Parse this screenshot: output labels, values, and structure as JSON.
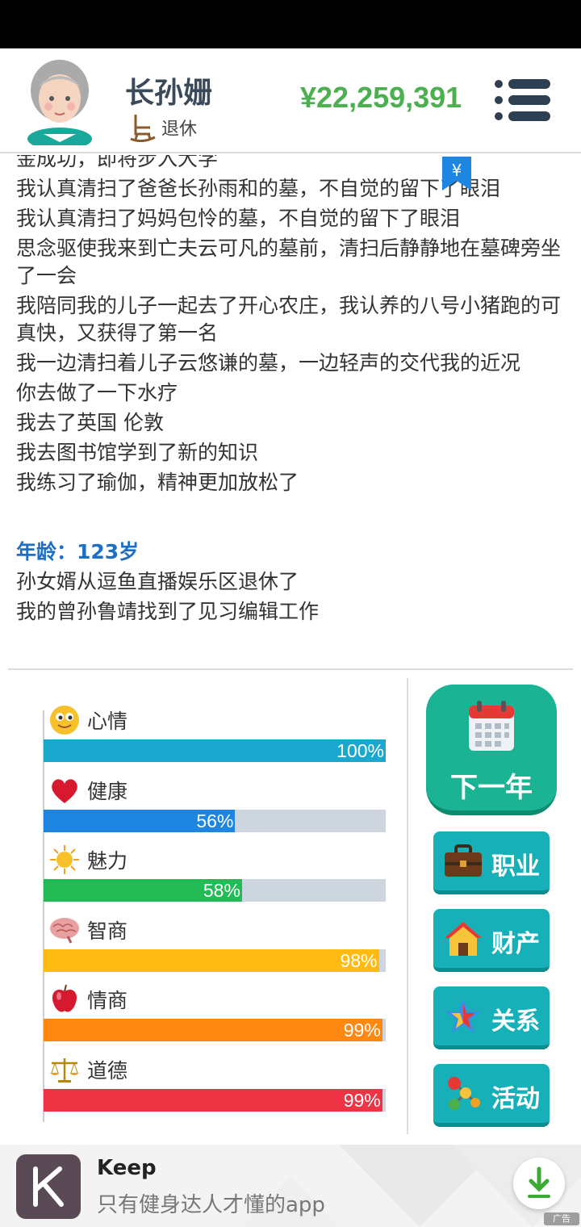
{
  "header": {
    "name": "长孙姗",
    "status": "退休",
    "money": "¥22,259,391"
  },
  "log": {
    "lines_before": [
      "金成功，即将步入大学",
      "我认真清扫了爸爸长孙雨和的墓，不自觉的留下了眼泪",
      "我认真清扫了妈妈包怜的墓，不自觉的留下了眼泪",
      "思念驱使我来到亡夫云可凡的墓前，清扫后静静地在墓碑旁坐了一会",
      "我陪同我的儿子一起去了开心农庄，我认养的八号小猪跑的可真快，又获得了第一名",
      "我一边清扫着儿子云悠谦的墓，一边轻声的交代我的近况",
      "你去做了一下水疗",
      "我去了英国 伦敦",
      "我去图书馆学到了新的知识",
      "我练习了瑜伽，精神更加放松了"
    ],
    "age_heading": "年龄：123岁",
    "lines_after": [
      "孙女婿从逗鱼直播娱乐区退休了",
      "我的曾孙鲁靖找到了见习编辑工作"
    ],
    "yen_tag": "¥"
  },
  "stats": [
    {
      "label": "心情",
      "icon": "smiley-icon",
      "value": 100,
      "pct": "100%",
      "color": "#1aa8cf"
    },
    {
      "label": "健康",
      "icon": "heart-icon",
      "value": 56,
      "pct": "56%",
      "color": "#1e86e0"
    },
    {
      "label": "魅力",
      "icon": "sun-icon",
      "value": 58,
      "pct": "58%",
      "color": "#22bb55"
    },
    {
      "label": "智商",
      "icon": "brain-icon",
      "value": 98,
      "pct": "98%",
      "color": "#ffbb11"
    },
    {
      "label": "情商",
      "icon": "apple-icon",
      "value": 99,
      "pct": "99%",
      "color": "#ff8811"
    },
    {
      "label": "道德",
      "icon": "scales-icon",
      "value": 99,
      "pct": "99%",
      "color": "#ee3344"
    }
  ],
  "actions": {
    "next_year": "下一年",
    "career": "职业",
    "property": "财产",
    "relations": "关系",
    "activity": "活动"
  },
  "ad": {
    "title": "Keep",
    "description": "只有健身达人才懂的app",
    "badge": "广告"
  }
}
